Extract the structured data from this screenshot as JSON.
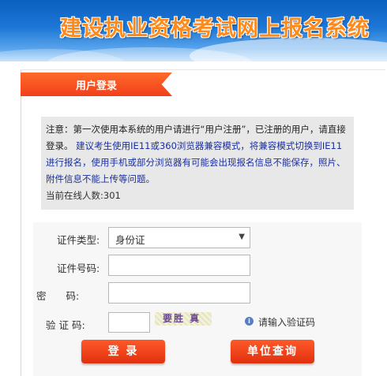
{
  "header": {
    "title": "建设执业资格考试网上报名系统"
  },
  "tab": {
    "label": "用户登录"
  },
  "notice": {
    "line1": "注意：第一次使用本系统的用户请进行“用户注册”，已注册的用户，请直接登录。",
    "line2": "建议考生使用IE11或360浏览器兼容模式，将兼容模式切换到IE11进行报名，使用手机或部分浏览器有可能会出现报名信息不能保存，照片、附件信息不能上传等问题。",
    "online": "当前在线人数:301"
  },
  "form": {
    "id_type_label": "证件类型:",
    "id_type_value": "身份证",
    "id_number_label": "证件号码:",
    "id_number_value": "",
    "password_label": "密　　码:",
    "password_value": "",
    "captcha_label": "验 证 码:",
    "captcha_value": "",
    "captcha_image_text": "要胜 真",
    "captcha_hint": "请输入验证码"
  },
  "buttons": {
    "login": "登 录",
    "unit_query": "单位查询"
  },
  "colors": {
    "accent": "#f0401a",
    "notice_text_blue": "#1a2fa0",
    "banner": "#1d77d6"
  }
}
